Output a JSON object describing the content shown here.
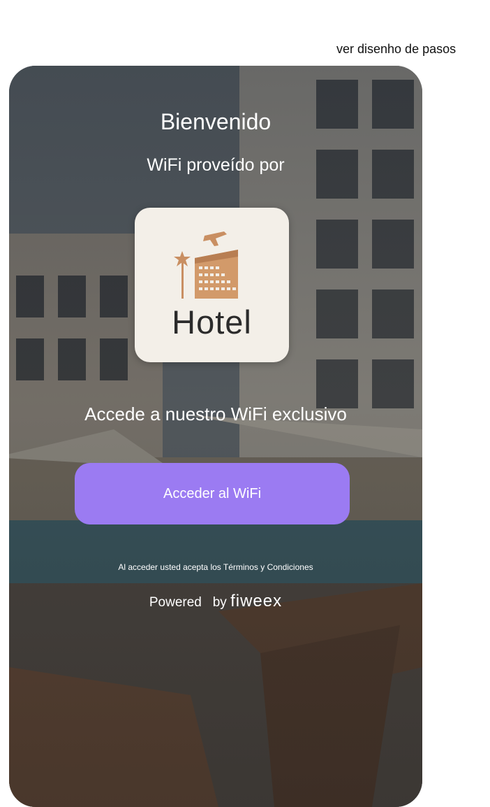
{
  "header": {
    "steps_link": "ver disenho de pasos"
  },
  "portal": {
    "welcome": "Bienvenido",
    "provided_by": "WiFi proveído por",
    "logo": {
      "text": "Hotel",
      "icon": "hotel-building-plane-palm-icon"
    },
    "tagline": "Accede a nuestro WiFi exclusivo",
    "cta_label": "Acceder al WiFi",
    "terms": "Al acceder usted acepta los Términos y Condiciones",
    "powered": {
      "prefix": "Powered",
      "by": "by",
      "brand": "fiweex"
    }
  },
  "colors": {
    "accent": "#9b7bf2",
    "logo_bg": "#f3efe8",
    "logo_copper": "#c98f62"
  }
}
